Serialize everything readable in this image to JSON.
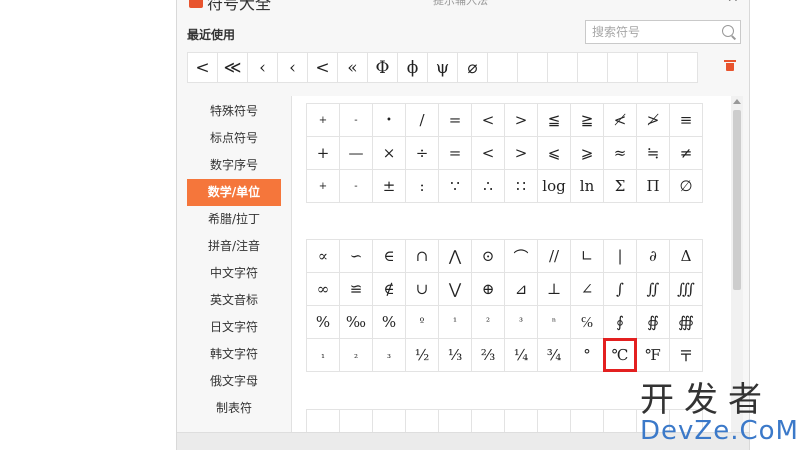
{
  "dialog": {
    "title": "符号大全",
    "title_sub": "提示辅入法",
    "close_glyph": "✕"
  },
  "recent": {
    "label": "最近使用",
    "symbols": [
      "<",
      "≪",
      "‹",
      "‹",
      "<",
      "«",
      "Φ",
      "ϕ",
      "ψ",
      "⌀",
      "",
      "",
      "",
      "",
      "",
      "",
      ""
    ]
  },
  "search": {
    "placeholder": "搜索符号",
    "value": ""
  },
  "categories": [
    {
      "label": "特殊符号",
      "active": false
    },
    {
      "label": "标点符号",
      "active": false
    },
    {
      "label": "数字序号",
      "active": false
    },
    {
      "label": "数学/单位",
      "active": true
    },
    {
      "label": "希腊/拉丁",
      "active": false
    },
    {
      "label": "拼音/注音",
      "active": false
    },
    {
      "label": "中文字符",
      "active": false
    },
    {
      "label": "英文音标",
      "active": false
    },
    {
      "label": "日文字符",
      "active": false
    },
    {
      "label": "韩文字符",
      "active": false
    },
    {
      "label": "俄文字母",
      "active": false
    },
    {
      "label": "制表符",
      "active": false
    }
  ],
  "grid_sections": [
    [
      [
        "+",
        "-",
        "•",
        "/",
        "=",
        "<",
        ">",
        "≦",
        "≧",
        "≮",
        "≯",
        "≡"
      ],
      [
        "+",
        "—",
        "×",
        "÷",
        "=",
        "<",
        ">",
        "⩽",
        "⩾",
        "≈",
        "≒",
        "≠"
      ],
      [
        "+",
        "-",
        "±",
        ":",
        "∵",
        "∴",
        "∷",
        "log",
        "ln",
        "Σ",
        "Π",
        "∅"
      ]
    ],
    [
      [
        "∝",
        "∽",
        "∈",
        "∩",
        "⋀",
        "⊙",
        "⌒",
        "//",
        "∟",
        "|",
        "∂",
        "Δ"
      ],
      [
        "∞",
        "≌",
        "∉",
        "∪",
        "⋁",
        "⊕",
        "⊿",
        "⊥",
        "∠",
        "∫",
        "∬",
        "∭"
      ],
      [
        "%",
        "‰",
        "%",
        "º",
        "¹",
        "²",
        "³",
        "ⁿ",
        "℅",
        "∮",
        "∯",
        "∰"
      ],
      [
        "₁",
        "₂",
        "₃",
        "½",
        "⅓",
        "⅔",
        "¼",
        "¾",
        "°",
        "℃",
        "℉",
        "〒"
      ]
    ]
  ],
  "highlighted_symbol": "℃",
  "colors": {
    "accent": "#f5763b",
    "highlight_box": "#e32020",
    "watermark_blue": "#3b79c9"
  },
  "watermark": {
    "cn": "开发者",
    "en": "DevZe.CoM"
  }
}
